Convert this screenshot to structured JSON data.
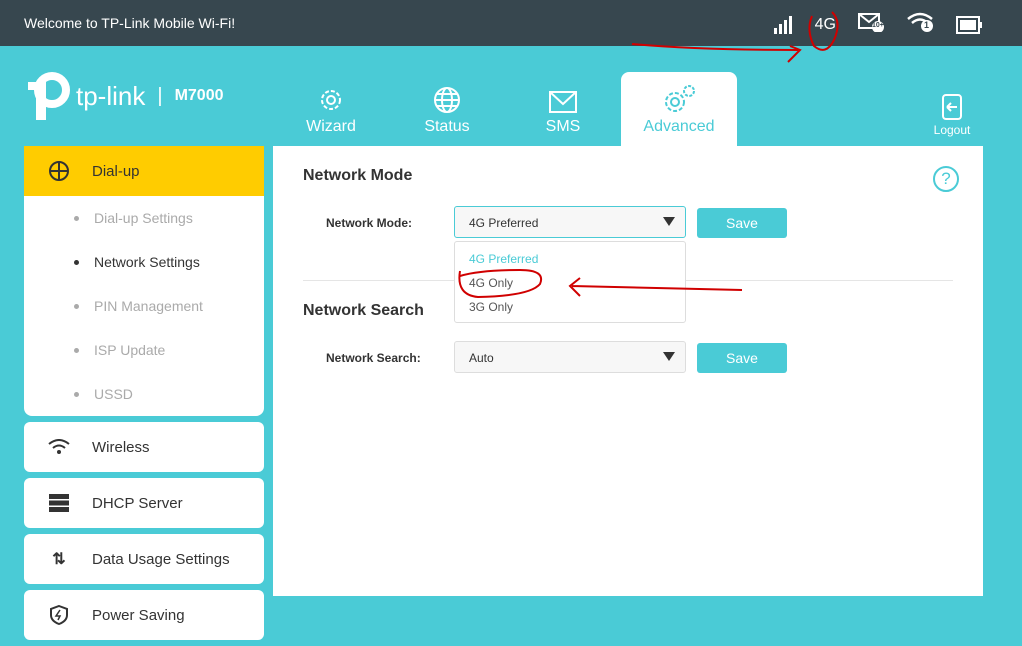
{
  "topbar": {
    "welcome": "Welcome to TP-Link Mobile Wi-Fi!",
    "network_type": "4G",
    "sms_badge": "10+",
    "wifi_clients": "1"
  },
  "logo": {
    "brand": "tp-link",
    "separator": "|",
    "model": "M7000"
  },
  "nav": {
    "tabs": [
      {
        "label": "Wizard"
      },
      {
        "label": "Status"
      },
      {
        "label": "SMS"
      },
      {
        "label": "Advanced"
      }
    ],
    "logout": "Logout"
  },
  "sidebar": {
    "dialup": "Dial-up",
    "sub": [
      "Dial-up Settings",
      "Network Settings",
      "PIN Management",
      "ISP Update",
      "USSD"
    ],
    "items": [
      "Wireless",
      "DHCP Server",
      "Data Usage Settings",
      "Power Saving"
    ]
  },
  "main": {
    "network_mode": {
      "title": "Network Mode",
      "label": "Network Mode:",
      "value": "4G Preferred",
      "options": [
        "4G Preferred",
        "4G Only",
        "3G Only"
      ],
      "save": "Save"
    },
    "network_search": {
      "title": "Network Search",
      "label": "Network Search:",
      "value": "Auto",
      "save": "Save"
    },
    "help": "?"
  },
  "colors": {
    "accent": "#4acbd6",
    "topbar": "#37474f",
    "active_menu": "#ffcc00",
    "annotation": "#d00000"
  }
}
